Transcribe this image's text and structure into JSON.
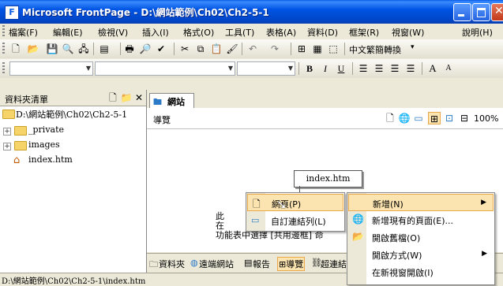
{
  "window": {
    "title": "Microsoft FrontPage - D:\\網站範例\\Ch02\\Ch2-5-1",
    "app_icon": "frontpage-icon"
  },
  "menubar": {
    "items": [
      "檔案(F)",
      "編輯(E)",
      "檢視(V)",
      "插入(I)",
      "格式(O)",
      "工具(T)",
      "表格(A)",
      "資料(D)",
      "框架(R)",
      "視窗(W)",
      "說明(H)"
    ]
  },
  "toolbar": {
    "convert_label": "中文繁簡轉換"
  },
  "formatting": {
    "bold": "B",
    "italic": "I",
    "underline": "U",
    "grow_font": "A",
    "shrink_font": "A"
  },
  "folder_panel": {
    "title": "資料夾清單",
    "root": "D:\\網站範例\\Ch02\\Ch2-5-1",
    "items": [
      "_private",
      "images",
      "index.htm"
    ]
  },
  "main": {
    "tab_label": "網站",
    "view_name": "導覽",
    "zoom": "100%",
    "node_label": "index.htm",
    "partial_lines": [
      "此",
      "在",
      "功能表中選擇 [共用邊框] 命"
    ]
  },
  "view_tabs": [
    "資料夾",
    "遠端網站",
    "報告",
    "導覽",
    "超連結"
  ],
  "statusbar": {
    "path": "D:\\網站範例\\Ch02\\Ch2-5-1\\index.htm"
  },
  "context_menu": {
    "items": [
      "新增(N)",
      "新增現有的頁面(E)...",
      "開啟舊檔(O)",
      "開啟方式(W)",
      "在新視窗開啟(I)"
    ]
  },
  "submenu": {
    "items": [
      "網頁(P)",
      "自訂連結列(L)"
    ]
  },
  "colors": {
    "titlebar": "#0054E3",
    "highlight": "#FBE4B0",
    "highlight_border": "#E9A84A"
  }
}
